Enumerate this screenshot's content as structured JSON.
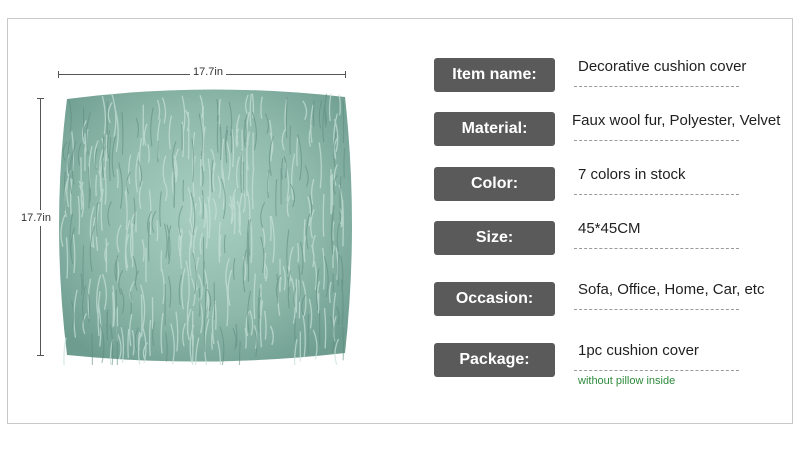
{
  "dimensions": {
    "width_label": "17.7in",
    "height_label": "17.7in"
  },
  "image": {
    "subject_icon": "faux-fur-pillow-image",
    "fur_color": "#8db8aa"
  },
  "specs": [
    {
      "label": "Item name:",
      "value": "Decorative cushion cover"
    },
    {
      "label": "Material:",
      "value": "Faux wool fur,  Polyester, Velvet"
    },
    {
      "label": "Color:",
      "value": "7 colors in stock"
    },
    {
      "label": "Size:",
      "value": "45*45CM"
    },
    {
      "label": "Occasion:",
      "value": "Sofa, Office, Home, Car, etc"
    },
    {
      "label": "Package:",
      "value": "1pc  cushion cover",
      "note": "without pillow inside"
    }
  ],
  "colors": {
    "label_bg": "#5a5a5a",
    "note_green": "#2e8b3d"
  }
}
